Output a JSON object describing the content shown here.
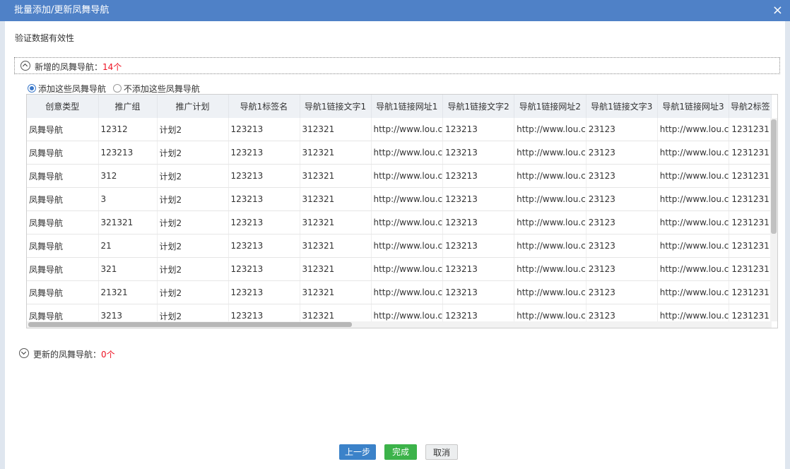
{
  "dialog": {
    "title": "批量添加/更新凤舞导航",
    "close_glyph": "×",
    "subtitle": "验证数据有效性"
  },
  "new_section": {
    "label": "新增的凤舞导航：",
    "count": "14个",
    "options": [
      "添加这些凤舞导航",
      "不添加这些凤舞导航"
    ],
    "selected_option": "添加这些凤舞导航"
  },
  "table": {
    "columns": [
      "创意类型",
      "推广组",
      "推广计划",
      "导航1标签名",
      "导航1链接文字1",
      "导航1链接网址1",
      "导航1链接文字2",
      "导航1链接网址2",
      "导航1链接文字3",
      "导航1链接网址3",
      "导航2标签"
    ],
    "rows": [
      [
        "凤舞导航",
        "12312",
        "计划2",
        "123213",
        "312321",
        "http://www.lou.c",
        "123213",
        "http://www.lou.c",
        "23123",
        "http://www.lou.c",
        "1231231"
      ],
      [
        "凤舞导航",
        "123213",
        "计划2",
        "123213",
        "312321",
        "http://www.lou.c",
        "123213",
        "http://www.lou.c",
        "23123",
        "http://www.lou.c",
        "1231231"
      ],
      [
        "凤舞导航",
        "312",
        "计划2",
        "123213",
        "312321",
        "http://www.lou.c",
        "123213",
        "http://www.lou.c",
        "23123",
        "http://www.lou.c",
        "1231231"
      ],
      [
        "凤舞导航",
        "3",
        "计划2",
        "123213",
        "312321",
        "http://www.lou.c",
        "123213",
        "http://www.lou.c",
        "23123",
        "http://www.lou.c",
        "1231231"
      ],
      [
        "凤舞导航",
        "321321",
        "计划2",
        "123213",
        "312321",
        "http://www.lou.c",
        "123213",
        "http://www.lou.c",
        "23123",
        "http://www.lou.c",
        "1231231"
      ],
      [
        "凤舞导航",
        "21",
        "计划2",
        "123213",
        "312321",
        "http://www.lou.c",
        "123213",
        "http://www.lou.c",
        "23123",
        "http://www.lou.c",
        "1231231"
      ],
      [
        "凤舞导航",
        "321",
        "计划2",
        "123213",
        "312321",
        "http://www.lou.c",
        "123213",
        "http://www.lou.c",
        "23123",
        "http://www.lou.c",
        "1231231"
      ],
      [
        "凤舞导航",
        "21321",
        "计划2",
        "123213",
        "312321",
        "http://www.lou.c",
        "123213",
        "http://www.lou.c",
        "23123",
        "http://www.lou.c",
        "1231231"
      ],
      [
        "凤舞导航",
        "3213",
        "计划2",
        "123213",
        "312321",
        "http://www.lou.c",
        "123213",
        "http://www.lou.c",
        "23123",
        "http://www.lou.c",
        "1231231"
      ]
    ]
  },
  "update_section": {
    "label": "更新的凤舞导航：",
    "count": "0个"
  },
  "buttons": {
    "prev": "上一步",
    "done": "完成",
    "cancel": "取消"
  },
  "colors": {
    "titlebar": "#4f81c7",
    "count_red": "#e12",
    "primary_button": "#3b82c9",
    "success_button": "#3cb34a"
  }
}
